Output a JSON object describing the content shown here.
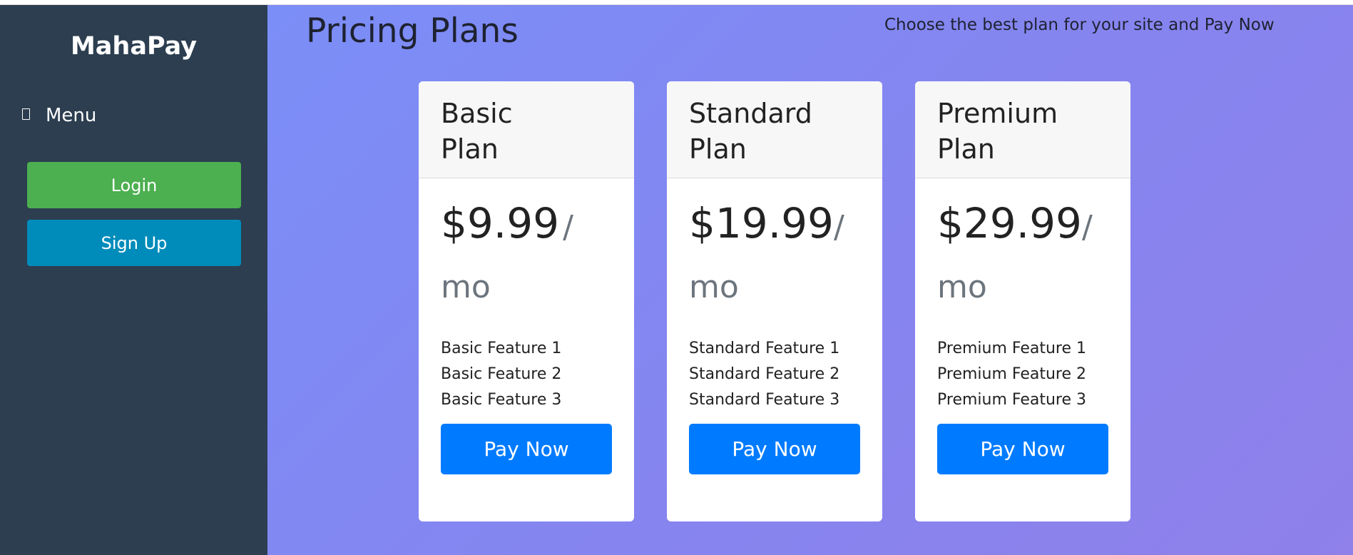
{
  "sidebar": {
    "brand": "MahaPay",
    "menu_label": "Menu",
    "login_label": "Login",
    "signup_label": "Sign Up"
  },
  "main": {
    "title": "Pricing Plans",
    "subtitle": "Choose the best plan for your site and Pay Now",
    "plans": [
      {
        "title": "Basic Plan",
        "price": "$9.99",
        "period": "/ mo",
        "features": [
          "Basic Feature 1",
          "Basic Feature 2",
          "Basic Feature 3"
        ],
        "button_label": "Pay Now"
      },
      {
        "title": "Standard Plan",
        "price": "$19.99",
        "period": "/ mo",
        "features": [
          "Standard Feature 1",
          "Standard Feature 2",
          "Standard Feature 3"
        ],
        "button_label": "Pay Now"
      },
      {
        "title": "Premium Plan",
        "price": "$29.99",
        "period": "/ mo",
        "features": [
          "Premium Feature 1",
          "Premium Feature 2",
          "Premium Feature 3"
        ],
        "button_label": "Pay Now"
      }
    ]
  },
  "colors": {
    "sidebar_bg": "#2c3e50",
    "login_green": "#4caf50",
    "signup_blue": "#008cba",
    "pay_blue": "#007bff",
    "main_gradient_start": "#7b8ef7",
    "main_gradient_end": "#8f80ea"
  },
  "icons": {
    "menu": "menu-icon"
  }
}
